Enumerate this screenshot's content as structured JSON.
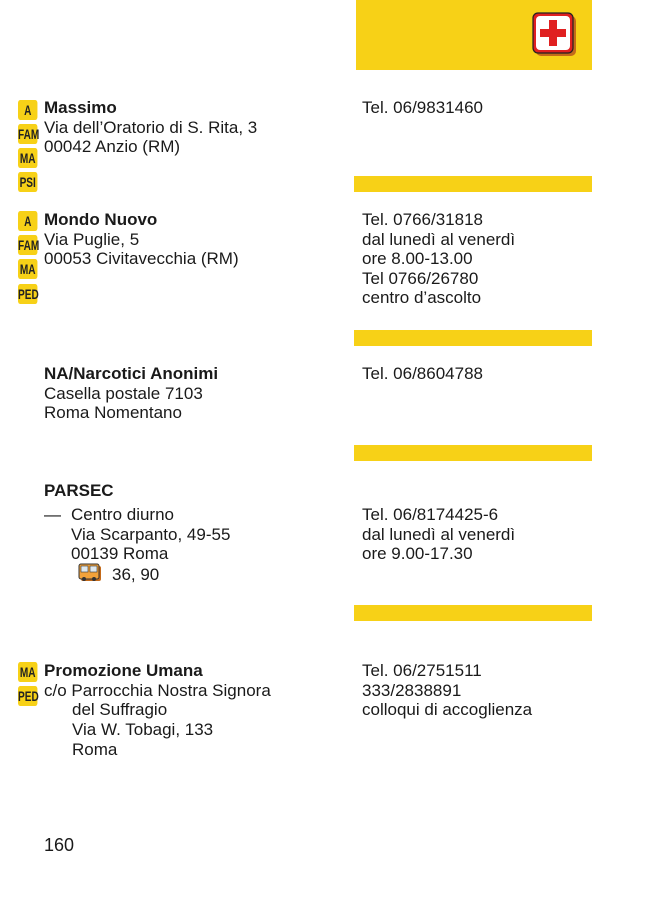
{
  "header": {
    "icon": "first-aid-icon",
    "accent_color": "#f7d117"
  },
  "entries": [
    {
      "tags": [
        "A",
        "FAM",
        "MA",
        "PSI"
      ],
      "name": "Massimo",
      "address": [
        "Via dell’Oratorio di S. Rita, 3",
        "00042 Anzio (RM)"
      ],
      "contact": [
        "Tel. 06/9831460"
      ]
    },
    {
      "tags": [
        "A",
        "FAM",
        "MA",
        "PED"
      ],
      "name": "Mondo Nuovo",
      "address": [
        "Via Puglie, 5",
        "00053 Civitavecchia (RM)"
      ],
      "contact": [
        "Tel. 0766/31818",
        "dal lunedì al venerdì",
        "ore 8.00-13.00",
        "Tel 0766/26780",
        "centro d’ascolto"
      ]
    },
    {
      "tags": [],
      "name": "NA/Narcotici Anonimi",
      "address": [
        "Casella postale 7103",
        "Roma Nomentano"
      ],
      "contact": [
        "Tel. 06/8604788"
      ]
    },
    {
      "tags": [],
      "name": "PARSEC",
      "sub_dash": "—",
      "address": [
        "Centro diurno",
        "Via Scarpanto, 49-55",
        "00139 Roma",
        "36, 90"
      ],
      "bus_icon": "bus-icon",
      "contact": [
        "Tel. 06/8174425-6",
        "dal lunedì al venerdì",
        "ore 9.00-17.30"
      ]
    },
    {
      "tags": [
        "MA",
        "PED"
      ],
      "name": "Promozione Umana",
      "address": [
        "c/o Parrocchia Nostra Signora",
        "del Suffragio",
        "Via W. Tobagi, 133",
        "Roma"
      ],
      "contact": [
        "Tel. 06/2751511",
        "333/2838891",
        "colloqui di accoglienza"
      ]
    }
  ],
  "page_number": "160"
}
